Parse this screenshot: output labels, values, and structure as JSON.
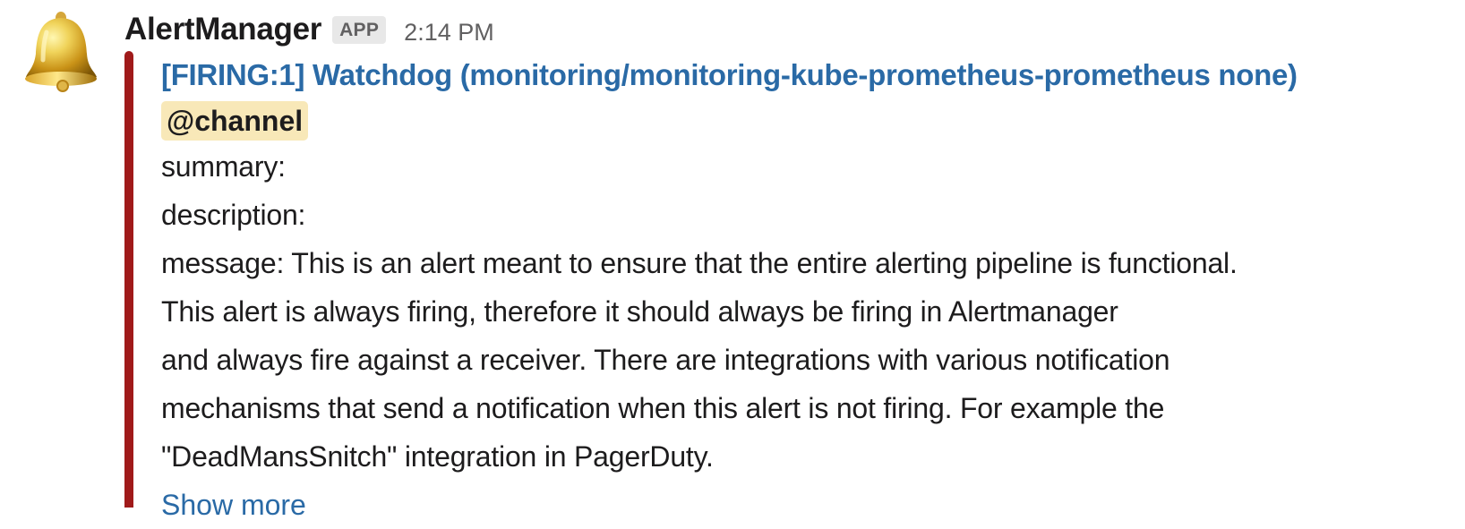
{
  "message": {
    "sender": "AlertManager",
    "badge": "APP",
    "timestamp": "2:14 PM",
    "avatar_icon": "bell-icon",
    "accent_color": "#a01a1a",
    "link_color": "#2a6aa6",
    "mention_background": "#f8e8b8"
  },
  "attachment": {
    "title": "[FIRING:1] Watchdog (monitoring/monitoring-kube-prometheus-prometheus none)",
    "mention": "@channel",
    "summary": "summary:",
    "description": "description:",
    "message_lines": [
      "message: This is an alert meant to ensure that the entire alerting pipeline is functional.",
      "This alert is always firing, therefore it should always be firing in Alertmanager",
      "and always fire against a receiver. There are integrations with various notification",
      "mechanisms that send a notification when this alert is not firing. For example the",
      "\"DeadMansSnitch\" integration in PagerDuty."
    ],
    "show_more": "Show more"
  }
}
